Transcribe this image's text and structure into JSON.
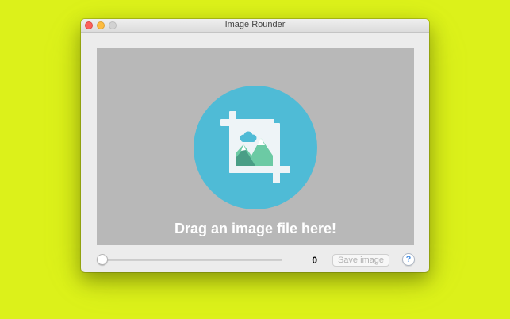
{
  "window": {
    "title": "Image Rounder"
  },
  "drop_zone": {
    "prompt": "Drag an image file here!",
    "icon": "crop-image-icon"
  },
  "controls": {
    "radius_slider_value": 0,
    "radius_label": "0",
    "save_label": "Save image",
    "save_enabled": false,
    "help_label": "?"
  },
  "colors": {
    "desktop": "#dcf11a",
    "drop_zone": "#b8b8b8",
    "icon_circle": "#4fbbd6",
    "icon_frame": "#eef4f7",
    "mountain_dark": "#4a9e86",
    "mountain_light": "#6ccaa4"
  }
}
